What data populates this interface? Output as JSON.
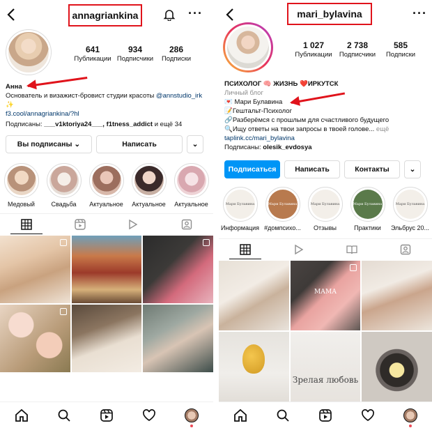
{
  "left": {
    "handle": "annagriankina",
    "stats": [
      {
        "value": "641",
        "label": "Публикации"
      },
      {
        "value": "934",
        "label": "Подписчики"
      },
      {
        "value": "286",
        "label": "Подписки"
      }
    ],
    "name": "Анна",
    "bio_line1": "Основатель и визажист-бровист студии красоты",
    "bio_mention": "@annstudio_irk",
    "bio_sparkle": "✨",
    "bio_link": "f3.cool/annagriankina/?hl",
    "followed_prefix": "Подписаны:",
    "followed_names": "___v1ktoriya24___, f1tness_addict",
    "followed_suffix": "и ещё 34",
    "following_button": "Вы подписаны",
    "message_button": "Написать",
    "highlights": [
      "Медовый",
      "Свадьба",
      "Актуальное",
      "Актуальное",
      "Актуальное"
    ]
  },
  "right": {
    "handle": "mari_bylavina",
    "stats": [
      {
        "value": "1 027",
        "label": "Публикации"
      },
      {
        "value": "2 738",
        "label": "Подписчики"
      },
      {
        "value": "585",
        "label": "Подписки"
      }
    ],
    "title": "ПСИХОЛОГ 🧠 ЖИЗНЬ ❤️ИРКУТСК",
    "category": "Личный блог",
    "bio_lines": [
      "💌 Мари Булавина",
      "📝Гештальт-Психолог",
      "🔗Разберёмся с прошлым для счастливого будущего",
      "🔍Ищу ответы на твои запросы в твоей голове..."
    ],
    "more": "ещё",
    "bio_link": "taplink.cc/mari_bylavina",
    "followed_prefix": "Подписаны:",
    "followed_names": "olesik_evdosya",
    "subscribe_button": "Подписаться",
    "message_button": "Написать",
    "contacts_button": "Контакты",
    "highlights": [
      "Информация",
      "#домпсихо...",
      "Отзывы",
      "Практики",
      "Эльбрус 20..."
    ],
    "highlight_brand": "Мари Булавина",
    "post_text_1": "МАМА",
    "post_text_2": "Зрелая любовь"
  },
  "colors": {
    "accent_red": "#e0131b",
    "link_blue": "#00376b",
    "button_blue": "#0095f6",
    "highlight_green": "#5a7a4a",
    "highlight_brown": "#b87a4e"
  }
}
